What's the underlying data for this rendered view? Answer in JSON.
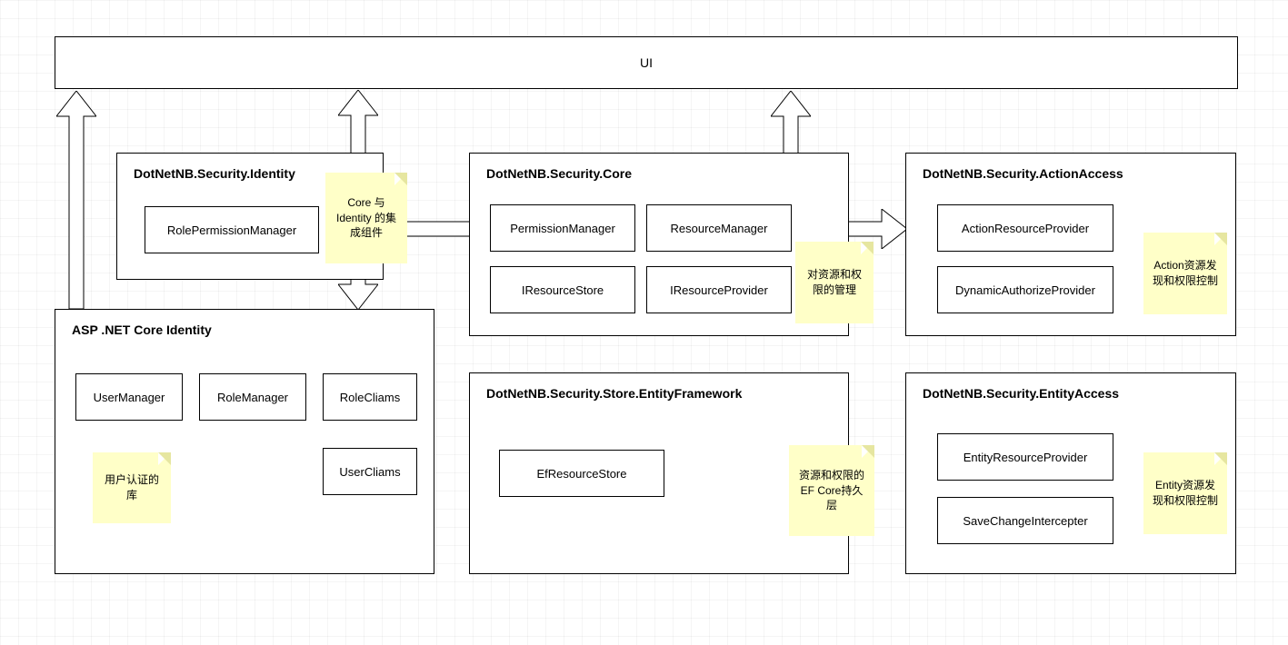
{
  "ui_box": {
    "label": "UI"
  },
  "identity_module": {
    "title": "DotNetNB.Security.Identity",
    "items": [
      "RolePermissionManager"
    ],
    "note": "Core 与 Identity 的集成组件"
  },
  "core_module": {
    "title": "DotNetNB.Security.Core",
    "items": [
      "PermissionManager",
      "ResourceManager",
      "IResourceStore",
      "IResourceProvider"
    ],
    "note": "对资源和权限的管理"
  },
  "action_module": {
    "title": "DotNetNB.Security.ActionAccess",
    "items": [
      "ActionResourceProvider",
      "DynamicAuthorizeProvider"
    ],
    "note": "Action资源发现和权限控制"
  },
  "asp_module": {
    "title": "ASP .NET Core Identity",
    "items": [
      "UserManager",
      "RoleManager",
      "RoleCliams",
      "UserCliams"
    ],
    "note": "用户认证的库"
  },
  "store_module": {
    "title": "DotNetNB.Security.Store.EntityFramework",
    "items": [
      "EfResourceStore"
    ],
    "note": "资源和权限的EF Core持久层"
  },
  "entity_module": {
    "title": "DotNetNB.Security.EntityAccess",
    "items": [
      "EntityResourceProvider",
      "SaveChangeIntercepter"
    ],
    "note": "Entity资源发现和权限控制"
  }
}
